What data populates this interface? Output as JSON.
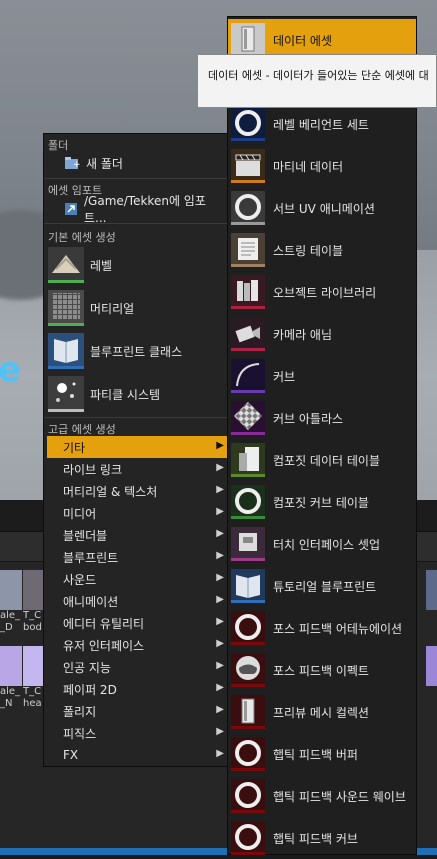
{
  "menu": {
    "sections": {
      "folder": "폴더",
      "import": "에셋 임포트",
      "basic": "기본 에셋 생성",
      "advanced": "고급 에셋 생성"
    },
    "new_folder": "새 폴더",
    "import_path": "/Game/Tekken에 임포트...",
    "basic_items": [
      {
        "label": "레벨",
        "icon": "level-icon"
      },
      {
        "label": "머티리얼",
        "icon": "material-icon"
      },
      {
        "label": "블루프린트 클래스",
        "icon": "blueprint-icon"
      },
      {
        "label": "파티클 시스템",
        "icon": "particle-icon"
      }
    ],
    "advanced_items": [
      "기타",
      "라이브 링크",
      "머티리얼 & 텍스처",
      "미디어",
      "블렌더블",
      "블루프린트",
      "사운드",
      "애니메이션",
      "에디터 유틸리티",
      "유저 인터페이스",
      "인공 지능",
      "페이퍼 2D",
      "폴리지",
      "피직스",
      "FX"
    ],
    "selected_advanced": "기타"
  },
  "submenu": {
    "items": [
      {
        "label": "데이터 에셋",
        "icon": "data-asset-icon"
      },
      {
        "label": "",
        "icon": "hidden"
      },
      {
        "label": "레벨 베리언트 세트",
        "icon": "ring-icon"
      },
      {
        "label": "마티네 데이터",
        "icon": "clapper-icon"
      },
      {
        "label": "서브 UV 애니메이션",
        "icon": "ring-icon"
      },
      {
        "label": "스트링 테이블",
        "icon": "string-table-icon"
      },
      {
        "label": "오브젝트 라이브러리",
        "icon": "books-icon"
      },
      {
        "label": "카메라 애님",
        "icon": "camera-icon"
      },
      {
        "label": "커브",
        "icon": "curve-icon"
      },
      {
        "label": "커브 아틀라스",
        "icon": "checker-icon"
      },
      {
        "label": "컴포짓 데이터 테이블",
        "icon": "composite-table-icon"
      },
      {
        "label": "컴포짓 커브 테이블",
        "icon": "ring-icon"
      },
      {
        "label": "터치 인터페이스 셋업",
        "icon": "touch-icon"
      },
      {
        "label": "튜토리얼 블루프린트",
        "icon": "blueprint-icon"
      },
      {
        "label": "포스 피드백 어테뉴에이션",
        "icon": "ring-icon"
      },
      {
        "label": "포스 피드백 이펙트",
        "icon": "gamepad-icon"
      },
      {
        "label": "프리뷰 메시 컬렉션",
        "icon": "mesh-icon"
      },
      {
        "label": "햅틱 피드백 버퍼",
        "icon": "ring-icon"
      },
      {
        "label": "햅틱 피드백 사운드 웨이브",
        "icon": "ring-icon"
      },
      {
        "label": "햅틱 피드백 커브",
        "icon": "ring-icon"
      }
    ]
  },
  "tooltip": {
    "text": "데이터 에셋 - 데이터가 들어있는 단순 에셋에 대"
  },
  "content_browser": {
    "assets": [
      {
        "top": "ale_",
        "bottom": "_D"
      },
      {
        "top": "T_C",
        "bottom": "bod"
      },
      {
        "top": "ale_",
        "bottom": "_N"
      },
      {
        "top": "T_C",
        "bottom": "hea"
      }
    ]
  },
  "colors": {
    "accent": "#e5a00d",
    "menu_bg": "#242424",
    "tooltip_bg": "#f3f3f3"
  }
}
